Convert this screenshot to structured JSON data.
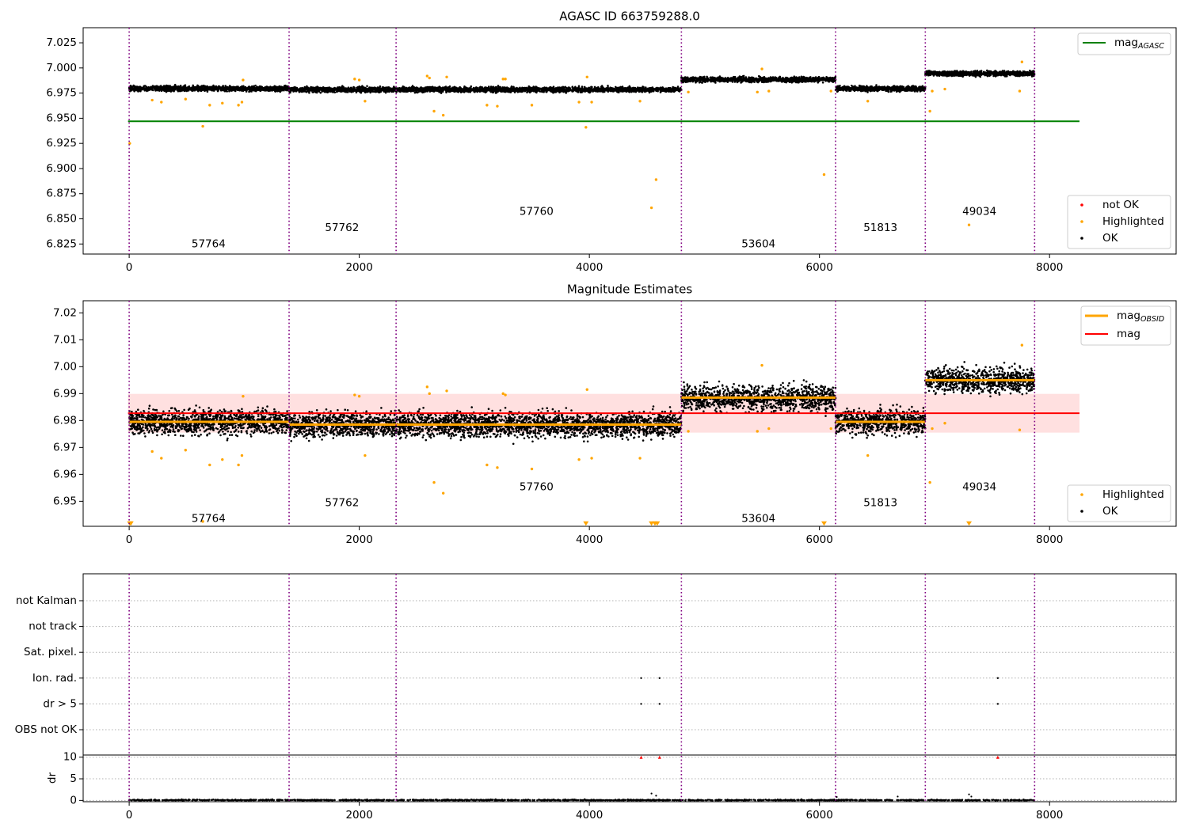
{
  "chart_data": [
    {
      "type": "scatter",
      "title": "AGASC ID 663759288.0",
      "xlim": [
        -400,
        9100
      ],
      "ylim": [
        6.815,
        7.04
      ],
      "x_ticks": [
        0,
        2000,
        4000,
        6000,
        8000
      ],
      "x_tick_labels": [
        "0",
        "2000",
        "4000",
        "6000",
        "8000"
      ],
      "y_ticks": [
        6.825,
        6.85,
        6.875,
        6.9,
        6.925,
        6.95,
        6.975,
        7.0,
        7.025
      ],
      "y_tick_labels": [
        "6.825",
        "6.850",
        "6.875",
        "6.900",
        "6.925",
        "6.950",
        "6.975",
        "7.000",
        "7.025"
      ],
      "obs_boundaries": [
        0,
        1390,
        2320,
        4800,
        6140,
        6920,
        7870
      ],
      "obsid_labels": [
        {
          "text": "57764",
          "x": 690,
          "y": 6.825
        },
        {
          "text": "57762",
          "x": 1850,
          "y": 6.841
        },
        {
          "text": "57760",
          "x": 3540,
          "y": 6.857
        },
        {
          "text": "53604",
          "x": 5470,
          "y": 6.825
        },
        {
          "text": "51813",
          "x": 6530,
          "y": 6.841
        },
        {
          "text": "49034",
          "x": 7390,
          "y": 6.857
        }
      ],
      "segments": [
        {
          "x0": 0,
          "x1": 1390,
          "level": 6.9795,
          "spread": 0.0025
        },
        {
          "x0": 1390,
          "x1": 2320,
          "level": 6.9785,
          "spread": 0.0025
        },
        {
          "x0": 2320,
          "x1": 4800,
          "level": 6.9785,
          "spread": 0.0025
        },
        {
          "x0": 4800,
          "x1": 6140,
          "level": 6.9885,
          "spread": 0.0025
        },
        {
          "x0": 6140,
          "x1": 6920,
          "level": 6.9795,
          "spread": 0.0025
        },
        {
          "x0": 6920,
          "x1": 7870,
          "level": 6.9945,
          "spread": 0.0025
        }
      ],
      "highlighted_points": [
        [
          5,
          6.925
        ],
        [
          200,
          6.968
        ],
        [
          280,
          6.966
        ],
        [
          490,
          6.969
        ],
        [
          640,
          6.942
        ],
        [
          700,
          6.963
        ],
        [
          810,
          6.965
        ],
        [
          950,
          6.963
        ],
        [
          980,
          6.966
        ],
        [
          990,
          6.988
        ],
        [
          1960,
          6.989
        ],
        [
          2000,
          6.988
        ],
        [
          2050,
          6.967
        ],
        [
          2590,
          6.992
        ],
        [
          2610,
          6.99
        ],
        [
          2650,
          6.957
        ],
        [
          2730,
          6.953
        ],
        [
          2760,
          6.991
        ],
        [
          3110,
          6.963
        ],
        [
          3200,
          6.962
        ],
        [
          3250,
          6.989
        ],
        [
          3270,
          6.989
        ],
        [
          3500,
          6.963
        ],
        [
          3910,
          6.966
        ],
        [
          3970,
          6.941
        ],
        [
          3980,
          6.991
        ],
        [
          4020,
          6.966
        ],
        [
          4440,
          6.967
        ],
        [
          4540,
          6.861
        ],
        [
          4580,
          6.889
        ],
        [
          4860,
          6.976
        ],
        [
          5460,
          6.976
        ],
        [
          5500,
          6.999
        ],
        [
          5560,
          6.977
        ],
        [
          6040,
          6.894
        ],
        [
          6100,
          6.977
        ],
        [
          6420,
          6.967
        ],
        [
          6960,
          6.957
        ],
        [
          6980,
          6.977
        ],
        [
          7090,
          6.979
        ],
        [
          7300,
          6.844
        ],
        [
          7740,
          6.977
        ],
        [
          7760,
          7.006
        ]
      ],
      "reference_lines": [
        {
          "name": "mag_AGASC",
          "value": 6.947,
          "color": "#008000",
          "x0": -10,
          "x1": 8260
        }
      ],
      "legend_upper": {
        "placement": "top-right",
        "items": [
          {
            "label": "mag",
            "sub": "AGASC",
            "color": "#008000"
          }
        ]
      },
      "legend_lower": {
        "placement": "bottom-right",
        "items": [
          {
            "label": "not OK",
            "color": "#ff0000"
          },
          {
            "label": "Highlighted",
            "color": "#ffa500"
          },
          {
            "label": "OK",
            "color": "#000000"
          }
        ]
      }
    },
    {
      "type": "scatter",
      "title": "Magnitude Estimates",
      "xlim": [
        -400,
        9100
      ],
      "ylim": [
        6.9407,
        7.0245
      ],
      "x_ticks": [
        0,
        2000,
        4000,
        6000,
        8000
      ],
      "x_tick_labels": [
        "0",
        "2000",
        "4000",
        "6000",
        "8000"
      ],
      "y_ticks": [
        6.95,
        6.96,
        6.97,
        6.98,
        6.99,
        7.0,
        7.01,
        7.02
      ],
      "y_tick_labels": [
        "6.95",
        "6.96",
        "6.97",
        "6.98",
        "6.99",
        "7.00",
        "7.01",
        "7.02"
      ],
      "obs_boundaries": [
        0,
        1390,
        2320,
        4800,
        6140,
        6920,
        7870
      ],
      "obsid_labels": [
        {
          "text": "57764",
          "x": 690,
          "y": 6.9435
        },
        {
          "text": "57762",
          "x": 1850,
          "y": 6.9494
        },
        {
          "text": "57760",
          "x": 3540,
          "y": 6.9553
        },
        {
          "text": "53604",
          "x": 5470,
          "y": 6.9435
        },
        {
          "text": "51813",
          "x": 6530,
          "y": 6.9494
        },
        {
          "text": "49034",
          "x": 7390,
          "y": 6.9553
        }
      ],
      "mag_obsid": [
        {
          "x0": 0,
          "x1": 1390,
          "value": 6.9795
        },
        {
          "x0": 1390,
          "x1": 2320,
          "value": 6.9785
        },
        {
          "x0": 2320,
          "x1": 4800,
          "value": 6.9785
        },
        {
          "x0": 4800,
          "x1": 6140,
          "value": 6.9885
        },
        {
          "x0": 6140,
          "x1": 6920,
          "value": 6.9795
        },
        {
          "x0": 6920,
          "x1": 7870,
          "value": 6.995
        }
      ],
      "mag": {
        "value": 6.9827,
        "band": [
          6.9755,
          6.9899
        ],
        "x0": -10,
        "x1": 8260,
        "color": "#ff0000",
        "band_color": "#ffe0e0"
      },
      "segments": [
        {
          "x0": 0,
          "x1": 1390,
          "level": 6.9795,
          "spread": 0.0045
        },
        {
          "x0": 1390,
          "x1": 2320,
          "level": 6.9785,
          "spread": 0.0045
        },
        {
          "x0": 2320,
          "x1": 4800,
          "level": 6.9785,
          "spread": 0.0045
        },
        {
          "x0": 4800,
          "x1": 6140,
          "level": 6.9885,
          "spread": 0.0045
        },
        {
          "x0": 6140,
          "x1": 6920,
          "level": 6.9795,
          "spread": 0.0045
        },
        {
          "x0": 6920,
          "x1": 7870,
          "level": 6.995,
          "spread": 0.0045
        }
      ],
      "highlighted_points": [
        [
          200,
          6.9685
        ],
        [
          280,
          6.966
        ],
        [
          490,
          6.969
        ],
        [
          640,
          6.9425
        ],
        [
          700,
          6.9635
        ],
        [
          810,
          6.9655
        ],
        [
          950,
          6.9635
        ],
        [
          980,
          6.967
        ],
        [
          990,
          6.989
        ],
        [
          1960,
          6.9895
        ],
        [
          2000,
          6.989
        ],
        [
          2050,
          6.967
        ],
        [
          2590,
          6.9925
        ],
        [
          2610,
          6.99
        ],
        [
          2650,
          6.957
        ],
        [
          2730,
          6.953
        ],
        [
          2760,
          6.991
        ],
        [
          3110,
          6.9635
        ],
        [
          3200,
          6.9625
        ],
        [
          3250,
          6.99
        ],
        [
          3270,
          6.9895
        ],
        [
          3500,
          6.962
        ],
        [
          3910,
          6.9655
        ],
        [
          3980,
          6.9915
        ],
        [
          4020,
          6.966
        ],
        [
          4440,
          6.966
        ],
        [
          4860,
          6.976
        ],
        [
          5460,
          6.976
        ],
        [
          5500,
          7.0005
        ],
        [
          5560,
          6.977
        ],
        [
          6100,
          6.977
        ],
        [
          6420,
          6.967
        ],
        [
          6960,
          6.957
        ],
        [
          6980,
          6.977
        ],
        [
          7090,
          6.979
        ],
        [
          7740,
          6.9765
        ],
        [
          7760,
          7.008
        ]
      ],
      "offscale_markers": [
        [
          5,
          6.9418
        ],
        [
          15,
          6.9418
        ],
        [
          3970,
          6.9418
        ],
        [
          4540,
          6.9418
        ],
        [
          4570,
          6.9418
        ],
        [
          4590,
          6.9418
        ],
        [
          6040,
          6.9418
        ],
        [
          7300,
          6.9418
        ]
      ],
      "legend_upper": {
        "placement": "top-right",
        "items": [
          {
            "label": "mag",
            "sub": "OBSID",
            "color": "#ffa500"
          },
          {
            "label": "mag",
            "color": "#ff0000"
          }
        ]
      },
      "legend_lower": {
        "placement": "bottom-right",
        "items": [
          {
            "label": "Highlighted",
            "color": "#ffa500"
          },
          {
            "label": "OK",
            "color": "#000000"
          }
        ]
      }
    },
    {
      "type": "scatter",
      "title": "",
      "xlim": [
        -400,
        9100
      ],
      "x_ticks": [
        0,
        2000,
        4000,
        6000,
        8000
      ],
      "x_tick_labels": [
        "0",
        "2000",
        "4000",
        "6000",
        "8000"
      ],
      "obs_boundaries": [
        0,
        1390,
        2320,
        4800,
        6140,
        6920,
        7870
      ],
      "flag_labels": [
        "not Kalman",
        "not track",
        "Sat. pixel.",
        "Ion. rad.",
        "dr > 5",
        "OBS not OK"
      ],
      "flag_points": [
        {
          "flag": "Ion. rad.",
          "x": [
            4450,
            4610,
            7550
          ]
        },
        {
          "flag": "dr > 5",
          "x": [
            4450,
            4610,
            7550
          ]
        }
      ],
      "dr_panel": {
        "ylabel": "dr",
        "ylim": [
          -0.3,
          10.5
        ],
        "y_ticks": [
          0,
          5,
          10
        ],
        "y_tick_labels": [
          "0",
          "5",
          "10"
        ],
        "clipped_points": [
          4450,
          4610,
          7550
        ],
        "extra_points": [
          [
            4540,
            1.6
          ],
          [
            4580,
            1.1
          ],
          [
            6150,
            0.8
          ],
          [
            6680,
            0.9
          ],
          [
            7300,
            1.4
          ],
          [
            7320,
            0.9
          ]
        ]
      }
    }
  ]
}
